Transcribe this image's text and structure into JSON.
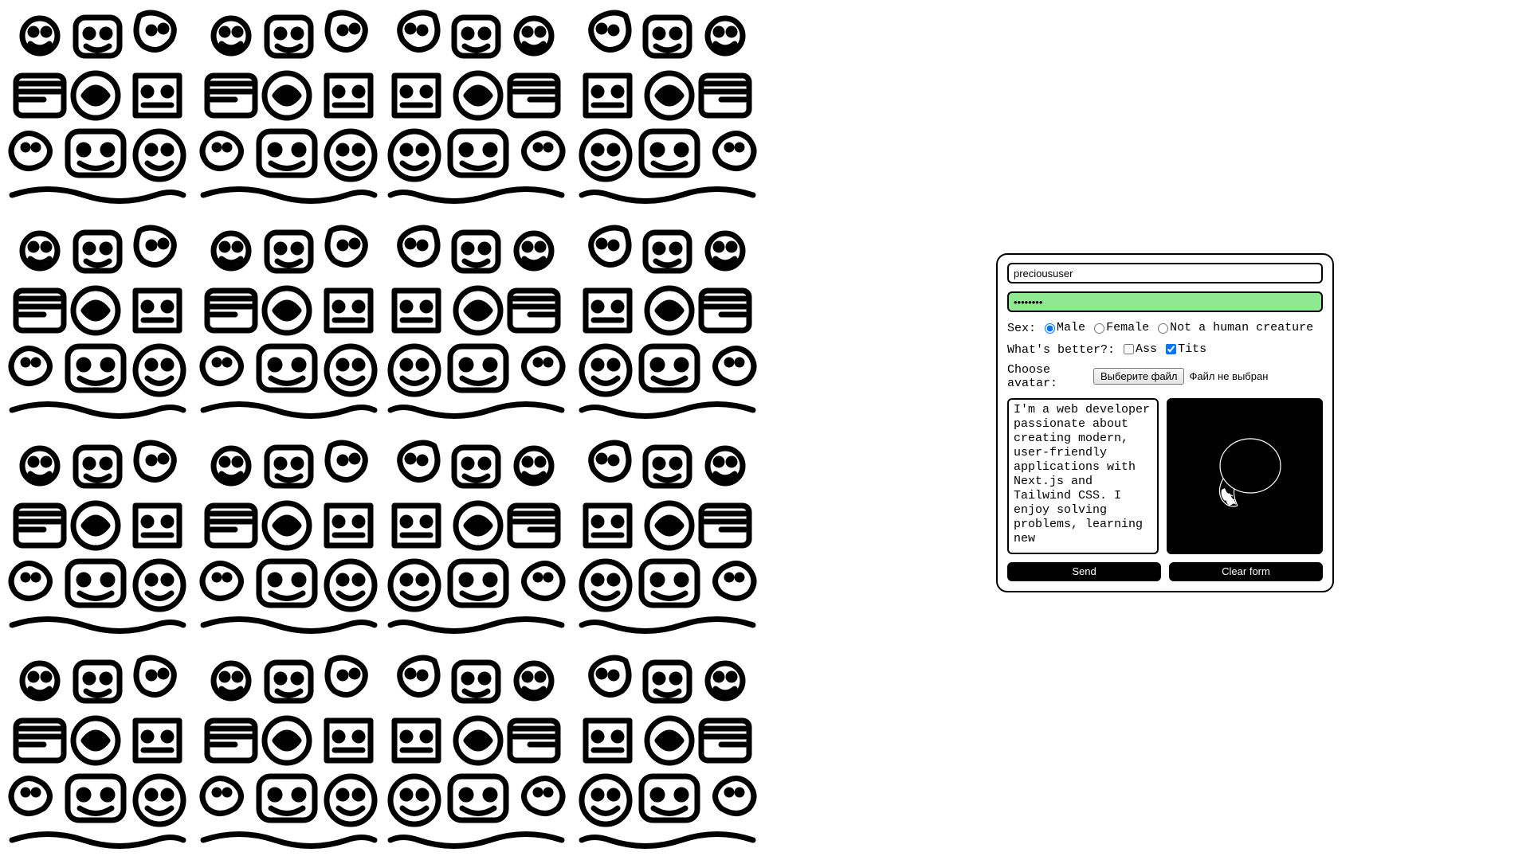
{
  "form": {
    "username": {
      "value": "precioususer",
      "placeholder": ""
    },
    "password": {
      "value": "••••••••"
    },
    "sex": {
      "label": "Sex:",
      "options": [
        {
          "label": "Male",
          "checked": true
        },
        {
          "label": "Female",
          "checked": false
        },
        {
          "label": "Not a human creature",
          "checked": false
        }
      ]
    },
    "better": {
      "label": "What's better?:",
      "options": [
        {
          "label": "Ass",
          "checked": false
        },
        {
          "label": "Tits",
          "checked": true
        }
      ]
    },
    "avatar": {
      "label": "Choose avatar:",
      "button": "Выберите файл",
      "status": "Файл не выбран"
    },
    "bio": {
      "value": "I'm a web developer passionate about creating modern, user-friendly applications with Next.js and Tailwind CSS. I enjoy solving problems, learning new"
    },
    "buttons": {
      "send": "Send",
      "clear": "Clear form"
    }
  }
}
